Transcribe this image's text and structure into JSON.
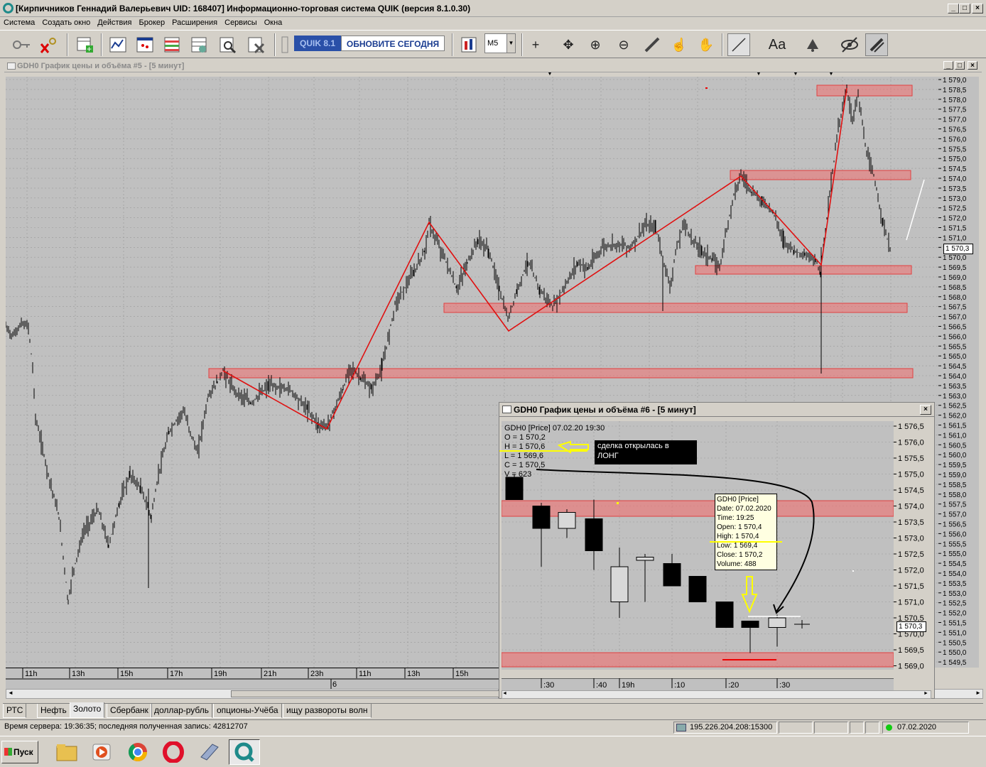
{
  "window": {
    "title": "[Кирпичников Геннадий Валерьевич UID: 168407] Информационно-торговая система QUIK (версия 8.1.0.30)"
  },
  "menu": [
    "Система",
    "Создать окно",
    "Действия",
    "Брокер",
    "Расширения",
    "Сервисы",
    "Окна"
  ],
  "toolbar": {
    "badge": "QUIK 8.1",
    "update_label": "ОБНОВИТЕ СЕГОДНЯ",
    "timeframe": "M5",
    "font_label": "Aa"
  },
  "chart1": {
    "title": "GDH0 График цены и объёма #5 - [5 минут]",
    "price_labels": [
      "1 579,0",
      "1 578,5",
      "1 578,0",
      "1 577,5",
      "1 577,0",
      "1 576,5",
      "1 576,0",
      "1 575,5",
      "1 575,0",
      "1 574,5",
      "1 574,0",
      "1 573,5",
      "1 573,0",
      "1 572,5",
      "1 572,0",
      "1 571,5",
      "1 571,0",
      "1 570,5",
      "1 570,0",
      "1 569,5",
      "1 569,0",
      "1 568,5",
      "1 568,0",
      "1 567,5",
      "1 567,0",
      "1 566,5",
      "1 566,0",
      "1 565,5",
      "1 565,0",
      "1 564,5",
      "1 564,0",
      "1 563,5",
      "1 563,0",
      "1 562,5",
      "1 562,0",
      "1 561,5",
      "1 561,0",
      "1 560,5",
      "1 560,0",
      "1 559,5",
      "1 559,0",
      "1 558,5",
      "1 558,0",
      "1 557,5",
      "1 557,0",
      "1 556,5",
      "1 556,0",
      "1 555,5",
      "1 555,0",
      "1 554,5",
      "1 554,0",
      "1 553,5",
      "1 553,0",
      "1 552,5",
      "1 552,0",
      "1 551,5",
      "1 551,0",
      "1 550,5",
      "1 550,0",
      "1 549,5"
    ],
    "current_price": "1 570,3",
    "time_labels": [
      "11h",
      "13h",
      "15h",
      "17h",
      "19h",
      "21h",
      "23h",
      "11h",
      "13h",
      "15h"
    ],
    "date_label": "6"
  },
  "chart2": {
    "title": "GDH0 График цены и объёма #6 - [5 минут]",
    "legend": [
      "GDH0 [Price] 07.02.20 19:30",
      "O = 1 570,2",
      "H = 1 570,6",
      "L = 1 569,6",
      "C = 1 570,5",
      "V = 623"
    ],
    "price_labels": [
      "1 576,5",
      "1 576,0",
      "1 575,5",
      "1 575,0",
      "1 574,5",
      "1 574,0",
      "1 573,5",
      "1 573,0",
      "1 572,5",
      "1 572,0",
      "1 571,5",
      "1 571,0",
      "1 570,5",
      "1 570,0",
      "1 569,5",
      "1 569,0"
    ],
    "current_price": "1 570,3",
    "time_labels": [
      ":30",
      ":40",
      "19h",
      ":10",
      ":20",
      ":30"
    ],
    "note": [
      "сделка открылась в",
      "ЛОНГ"
    ],
    "tooltip": [
      "GDH0 [Price]",
      "Date: 07.02.2020",
      "Time: 19:25",
      "Open:  1 570,4",
      "High:  1 570,4",
      "Low:   1 569,4",
      "Close: 1 570,2",
      "Volume: 488"
    ]
  },
  "tabs": [
    "РТС",
    "Нефть",
    "Золото",
    "Сбербанк",
    "доллар-рубль",
    "опционы-Учёба",
    "ищу развороты волн"
  ],
  "status": {
    "server_time": "Время сервера: 19:36:35; последняя полученная запись: 42812707",
    "connection": "195.226.204.208:15300",
    "date": "07.02.2020"
  },
  "taskbar": {
    "start": "Пуск"
  }
}
